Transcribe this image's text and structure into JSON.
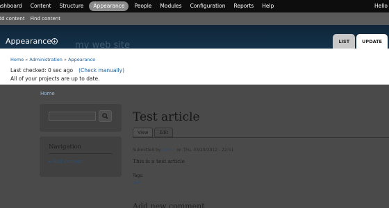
{
  "admin_menu": {
    "items": [
      "Dashboard",
      "Content",
      "Structure",
      "Appearance",
      "People",
      "Modules",
      "Configuration",
      "Reports",
      "Help"
    ],
    "right_label": "Hello"
  },
  "shortcuts": [
    "Add content",
    "Find content"
  ],
  "overlay": {
    "title": "Appearance",
    "site_name_ghost": "my web site",
    "tabs": [
      "LIST",
      "UPDATE"
    ],
    "breadcrumb": [
      "Home",
      "Administration",
      "Appearance"
    ],
    "breadcrumb_sep": "»",
    "last_checked": "Last checked: 0 sec ago",
    "check_manually": "(Check manually)",
    "up_to_date": "All of your projects are up to date."
  },
  "background_page": {
    "home_link": "Home",
    "search_icon": "search-icon",
    "nav_title": "Navigation",
    "nav_item": "Add content",
    "article_title": "Test article",
    "tabs": [
      "View",
      "Edit"
    ],
    "submitted_prefix": "Submitted by",
    "author": "admin",
    "submitted_suffix": "on Thu, 03/29/2012 - 22:51",
    "body": "This is a test article",
    "tags_label": "Tags:",
    "tag": "test",
    "comment_heading": "Add new comment"
  },
  "colors": {
    "toolbar": "#0d0d0d",
    "shortcut_bar": "#5a5a5a",
    "overlay_header": "#14324a",
    "link": "#1a5fa0",
    "dim_background": "#4a4a4a"
  }
}
